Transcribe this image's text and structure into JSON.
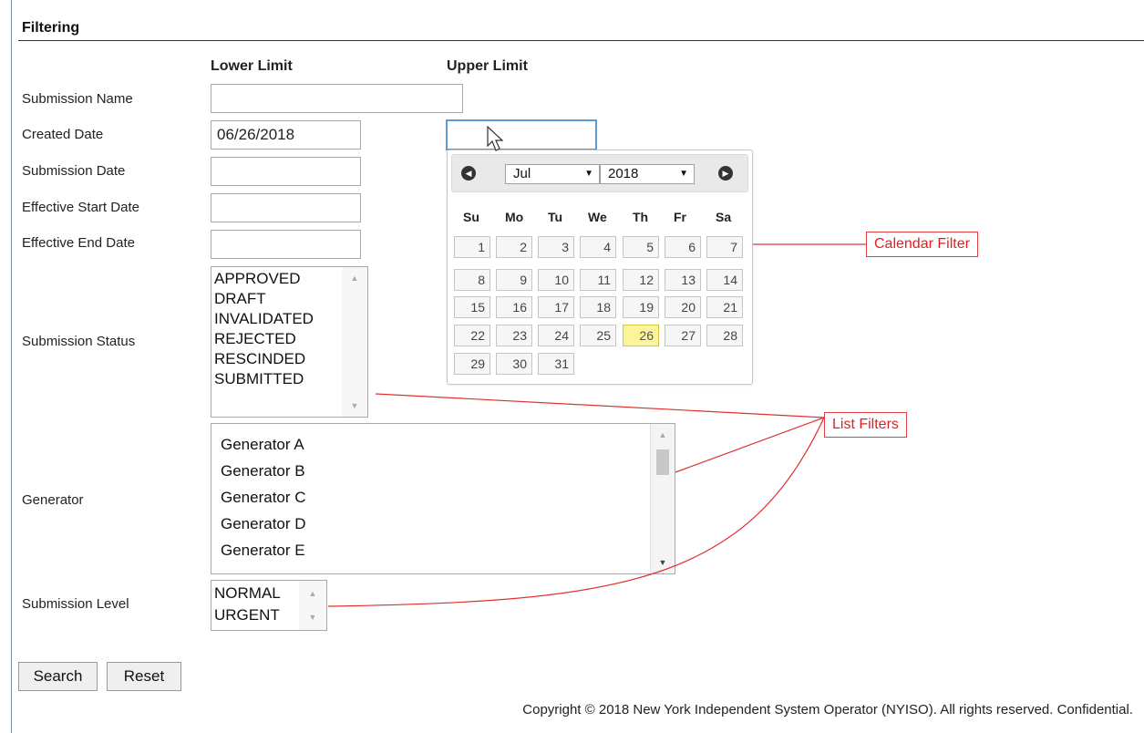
{
  "section": {
    "title": "Filtering"
  },
  "columns": {
    "lower": "Lower Limit",
    "upper": "Upper Limit"
  },
  "fields": {
    "submission_name": {
      "label": "Submission Name",
      "value": ""
    },
    "created_date": {
      "label": "Created Date",
      "lower_value": "06/26/2018",
      "upper_value": ""
    },
    "submission_date": {
      "label": "Submission Date",
      "value": ""
    },
    "effective_start_date": {
      "label": "Effective Start Date",
      "value": ""
    },
    "effective_end_date": {
      "label": "Effective End Date",
      "value": ""
    },
    "submission_status": {
      "label": "Submission Status",
      "options": [
        "APPROVED",
        "DRAFT",
        "INVALIDATED",
        "REJECTED",
        "RESCINDED",
        "SUBMITTED"
      ]
    },
    "generator": {
      "label": "Generator",
      "options": [
        "Generator A",
        "Generator B",
        "Generator C",
        "Generator D",
        "Generator E"
      ]
    },
    "submission_level": {
      "label": "Submission Level",
      "options": [
        "NORMAL",
        "URGENT"
      ]
    }
  },
  "calendar": {
    "month": "Jul",
    "year": "2018",
    "weekdays": [
      "Su",
      "Mo",
      "Tu",
      "We",
      "Th",
      "Fr",
      "Sa"
    ],
    "weeks": [
      [
        "1",
        "2",
        "3",
        "4",
        "5",
        "6",
        "7"
      ],
      [
        "8",
        "9",
        "10",
        "11",
        "12",
        "13",
        "14"
      ],
      [
        "15",
        "16",
        "17",
        "18",
        "19",
        "20",
        "21"
      ],
      [
        "22",
        "23",
        "24",
        "25",
        "26",
        "27",
        "28"
      ],
      [
        "29",
        "30",
        "31"
      ]
    ],
    "highlighted_day": "26",
    "highlight_color": "#fbf49a"
  },
  "buttons": {
    "search": "Search",
    "reset": "Reset"
  },
  "annotations": {
    "calendar_filter": "Calendar Filter",
    "list_filters": "List Filters",
    "color": "#e02020"
  },
  "footer": {
    "copyright": "Copyright © 2018 New York Independent System Operator (NYISO). All rights reserved. Confidential."
  }
}
